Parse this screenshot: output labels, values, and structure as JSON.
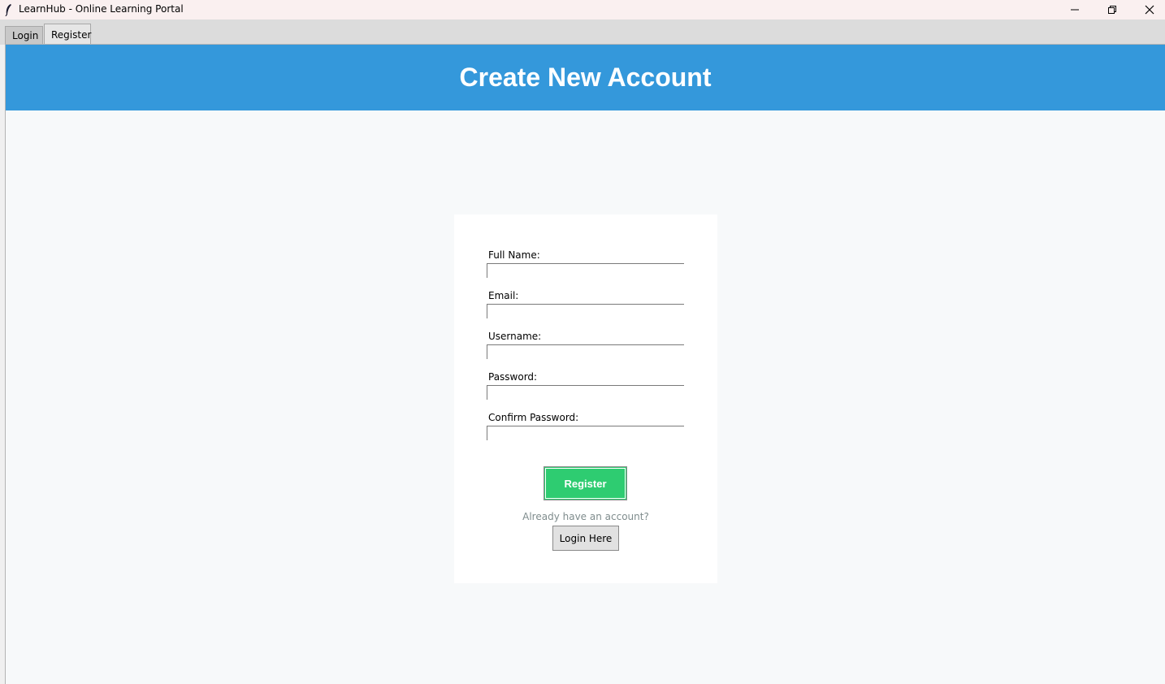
{
  "window": {
    "title": "LearnHub - Online Learning Portal"
  },
  "tabs": [
    {
      "label": "Login"
    },
    {
      "label": "Register"
    }
  ],
  "header": {
    "title": "Create New Account",
    "color": "#3498db"
  },
  "form": {
    "fields": [
      {
        "label": "Full Name:",
        "value": ""
      },
      {
        "label": "Email:",
        "value": ""
      },
      {
        "label": "Username:",
        "value": ""
      },
      {
        "label": "Password:",
        "value": ""
      },
      {
        "label": "Confirm Password:",
        "value": ""
      }
    ],
    "register_label": "Register",
    "register_color": "#2ecc71",
    "already_text": "Already have an account?",
    "login_here_label": "Login Here"
  }
}
